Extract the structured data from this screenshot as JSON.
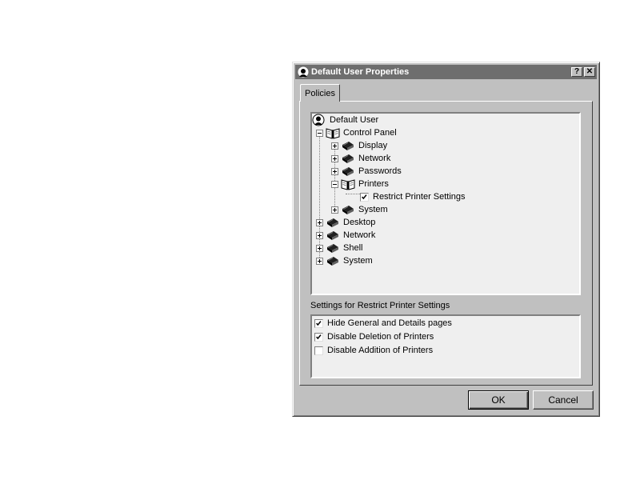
{
  "window": {
    "title": "Default User Properties",
    "help_label": "?",
    "close_label": "✕"
  },
  "tabs": [
    {
      "label": "Policies",
      "active": true
    }
  ],
  "tree": {
    "root": {
      "label": "Default User",
      "icon": "user-icon"
    },
    "nodes": [
      {
        "label": "Control Panel",
        "state": "expanded",
        "icon": "open-book-icon"
      },
      {
        "label": "Display",
        "state": "collapsed",
        "icon": "book-icon"
      },
      {
        "label": "Network",
        "state": "collapsed",
        "icon": "book-icon"
      },
      {
        "label": "Passwords",
        "state": "collapsed",
        "icon": "book-icon"
      },
      {
        "label": "Printers",
        "state": "expanded",
        "icon": "open-book-icon"
      },
      {
        "label": "Restrict Printer Settings",
        "checked": true
      },
      {
        "label": "System",
        "state": "collapsed",
        "icon": "book-icon"
      },
      {
        "label": "Desktop",
        "state": "collapsed",
        "icon": "book-icon"
      },
      {
        "label": "Network",
        "state": "collapsed",
        "icon": "book-icon"
      },
      {
        "label": "Shell",
        "state": "collapsed",
        "icon": "book-icon"
      },
      {
        "label": "System",
        "state": "collapsed",
        "icon": "book-icon"
      }
    ]
  },
  "settings": {
    "label": "Settings for Restrict Printer Settings",
    "options": [
      {
        "label": "Hide General and Details pages",
        "checked": true
      },
      {
        "label": "Disable Deletion of Printers",
        "checked": true
      },
      {
        "label": "Disable Addition of Printers",
        "checked": false
      }
    ]
  },
  "buttons": {
    "ok": "OK",
    "cancel": "Cancel"
  },
  "colors": {
    "titlebar": "#6e6e6e",
    "face": "#c0c0c0",
    "tree_bg": "#efefef"
  }
}
